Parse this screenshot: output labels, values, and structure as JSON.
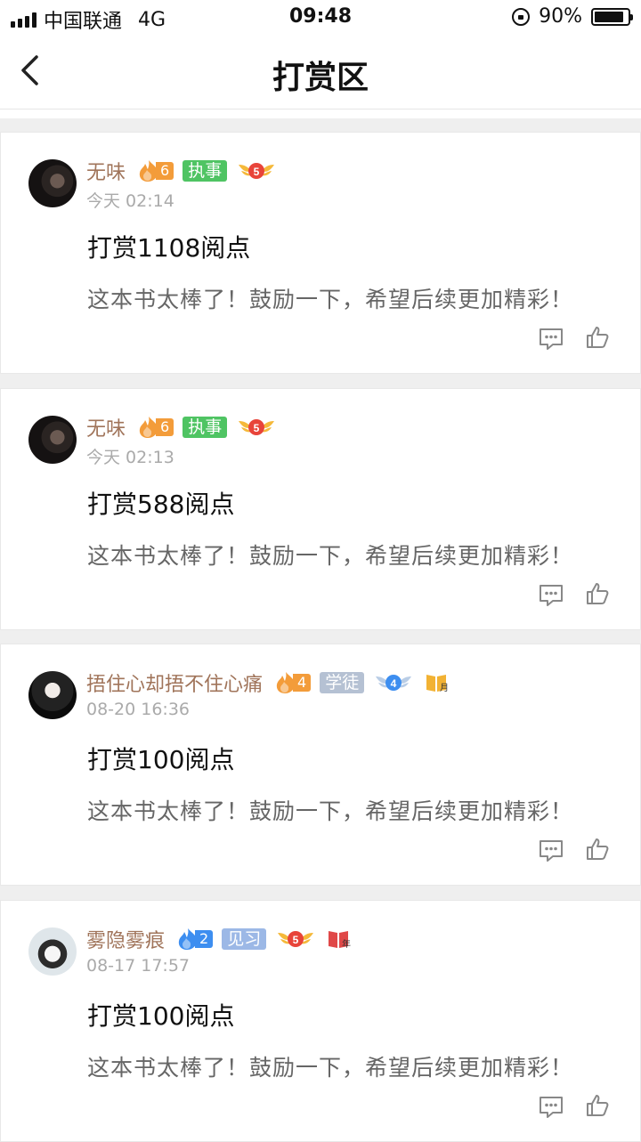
{
  "status_bar": {
    "carrier": "中国联通",
    "network": "4G",
    "time": "09:48",
    "battery": "90%",
    "battery_level": 0.9
  },
  "nav": {
    "title": "打赏区",
    "back_icon": "chevron-left-icon"
  },
  "colors": {
    "fire_orange": "#f39c3a",
    "fire_blue": "#3d8ef0",
    "tag_green": "#4fc463",
    "tag_gray": "#b5c1d3",
    "tag_blue": "#9cb8e6",
    "medal_red": "#e8443a",
    "medal_blue": "#3d8ef0"
  },
  "cards": [
    {
      "username": "无味",
      "fire_level": "6",
      "fire_color": "orange",
      "rank_tag": "执事",
      "rank_color": "green",
      "medal_level": "5",
      "medal_color": "red",
      "book": "",
      "date": "今天 02:14",
      "amount": "打赏1108阅点",
      "message": "这本书太棒了！鼓励一下，希望后续更加精彩！"
    },
    {
      "username": "无味",
      "fire_level": "6",
      "fire_color": "orange",
      "rank_tag": "执事",
      "rank_color": "green",
      "medal_level": "5",
      "medal_color": "red",
      "book": "",
      "date": "今天 02:13",
      "amount": "打赏588阅点",
      "message": "这本书太棒了！鼓励一下，希望后续更加精彩！"
    },
    {
      "username": "捂住心却捂不住心痛",
      "fire_level": "4",
      "fire_color": "orange",
      "rank_tag": "学徒",
      "rank_color": "gray",
      "medal_level": "4",
      "medal_color": "blue",
      "book": "月",
      "date": "08-20 16:36",
      "amount": "打赏100阅点",
      "message": "这本书太棒了！鼓励一下，希望后续更加精彩！"
    },
    {
      "username": "雾隐雾痕",
      "fire_level": "2",
      "fire_color": "blue",
      "rank_tag": "见习",
      "rank_color": "blue",
      "medal_level": "5",
      "medal_color": "red",
      "book": "年",
      "date": "08-17 17:57",
      "amount": "打赏100阅点",
      "message": "这本书太棒了！鼓励一下，希望后续更加精彩！"
    }
  ]
}
